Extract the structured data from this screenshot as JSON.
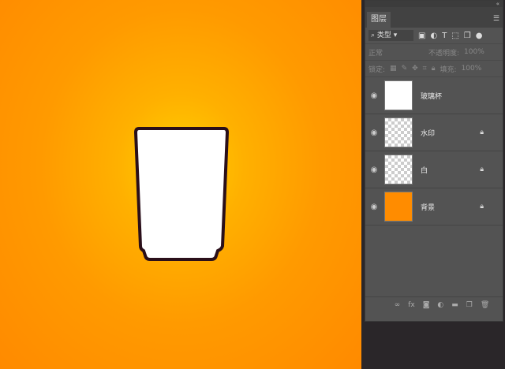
{
  "panel": {
    "tab": "图层",
    "filter": "类型",
    "blend_mode": "正常",
    "opacity_label": "不透明度:",
    "opacity": "100%",
    "lock_label": "锁定:",
    "fill_label": "填充:",
    "fill": "100%"
  },
  "layers": [
    {
      "name": "玻璃杯",
      "locked": false
    },
    {
      "name": "水印",
      "locked": true
    },
    {
      "name": "白",
      "locked": true
    },
    {
      "name": "背景",
      "locked": true
    }
  ],
  "colors": {
    "background": "#ff8c00",
    "cup_fill": "#ffffff",
    "cup_stroke": "#2a0f1a"
  }
}
